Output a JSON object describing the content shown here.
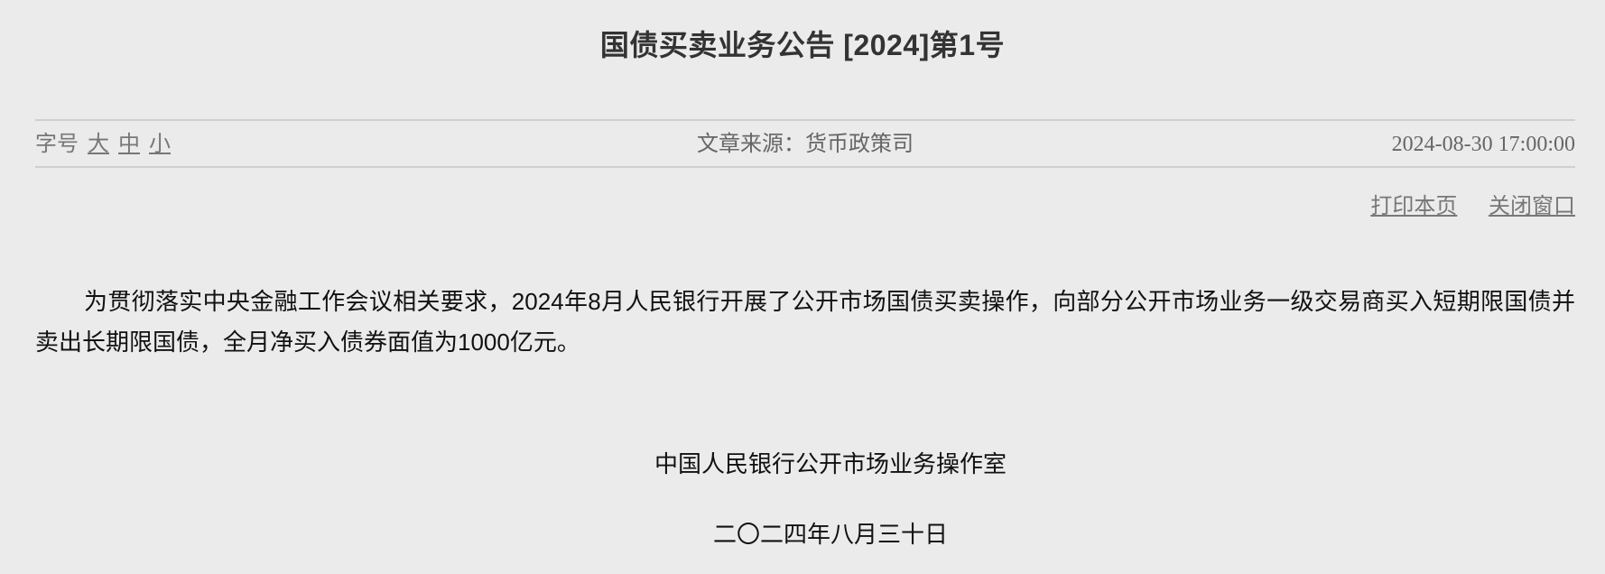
{
  "notice": {
    "title": "国债买卖业务公告 [2024]第1号"
  },
  "meta": {
    "font_size_label": "字号",
    "font_sizes": [
      "大",
      "中",
      "小"
    ],
    "source": "文章来源：货币政策司",
    "date": "2024-08-30 17:00:00"
  },
  "actions": {
    "print": "打印本页",
    "close": "关闭窗口"
  },
  "content": {
    "paragraph": "为贯彻落实中央金融工作会议相关要求，2024年8月人民银行开展了公开市场国债买卖操作，向部分公开市场业务一级交易商买入短期限国债并卖出长期限国债，全月净买入债券面值为1000亿元。"
  },
  "signature": {
    "org": "中国人民银行公开市场业务操作室",
    "date": "二〇二四年八月三十日"
  }
}
